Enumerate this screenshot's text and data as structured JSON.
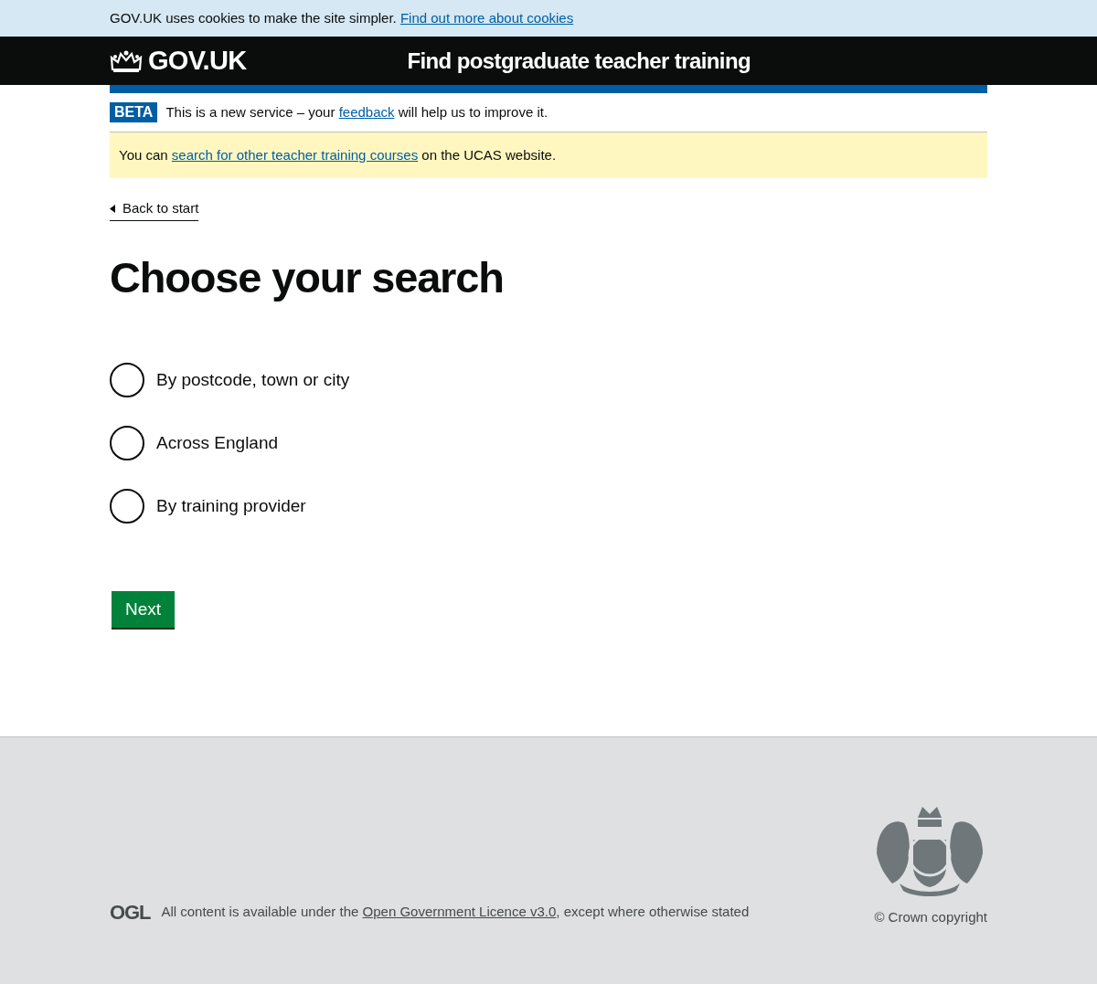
{
  "cookie_banner": {
    "text": "GOV.UK uses cookies to make the site simpler.",
    "link": "Find out more about cookies"
  },
  "header": {
    "logo_text": "GOV.UK",
    "service_name": "Find postgraduate teacher training"
  },
  "phase_banner": {
    "tag": "BETA",
    "text_before": "This is a new service – your",
    "link": "feedback",
    "text_after": "will help us to improve it."
  },
  "notice": {
    "text_before": "You can",
    "link": "search for other teacher training courses",
    "text_after": "on the UCAS website."
  },
  "back_link": "Back to start",
  "heading": "Choose your search",
  "radios": [
    {
      "label": "By postcode, town or city",
      "selected": false
    },
    {
      "label": "Across England",
      "selected": false
    },
    {
      "label": "By training provider",
      "selected": false
    }
  ],
  "button": "Next",
  "footer": {
    "ogl_logo": "OGL",
    "licence_before": "All content is available under the",
    "licence_link": "Open Government Licence v3.0",
    "licence_after": ", except where otherwise stated",
    "copyright": "© Crown copyright"
  }
}
